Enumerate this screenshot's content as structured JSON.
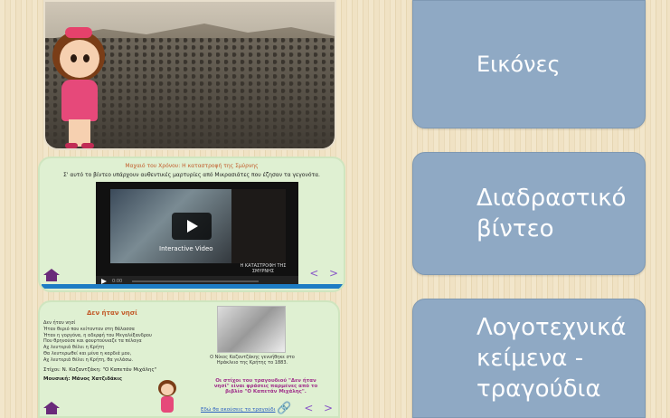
{
  "cards": {
    "photo": {},
    "video": {
      "title": "Μαχαιό του Χρόνου: Η καταστροφή της Σμύρνης",
      "subtitle": "Σ' αυτό το βίντεο υπάρχουν αυθεντικές μαρτυρίες από Μικρασιάτες που έζησαν τα γεγονότα.",
      "player_label": "Interactive Video",
      "player_caption": "Η ΚΑΤΑΣΤΡΟΦΗ ΤΗΣ ΣΜΥΡΝΗΣ",
      "time": "0:00",
      "prev": "<",
      "next": ">"
    },
    "literary": {
      "title": "Δεν ήταν νησί",
      "verses": [
        "Δεν ήταν νησί",
        "Ήταν θεριό που κείτονταν στη θάλασσα",
        "Ήταν η γοργόνα, η αδερφή του Μεγαλέξανδρου",
        "Που θρηνούσε και φουρτούνιαζε τα πέλαγα",
        "Αχ λευτεριά θέλει η Κρήτη",
        "Θα λευτερωθεί και μένα η καρδιά μου,",
        "Αχ λευτεριά θέλει η Κρήτη, θα γελάσω."
      ],
      "lyrics": "Στίχοι: Ν. Καζαντζάκη: \"Ο Καπετάν Μιχάλης\"",
      "music": "Μουσική: Μάνος Χατζιδάκις",
      "photo_caption": "Ο Νίκος Καζαντζάκης γεννήθηκε στο Ηράκλειο της Κρήτης το 1883.",
      "quote": "Οι στίχοι του τραγουδιού \"Δεν ήταν νησί\" είναι φράσεις παρμένες από το βιβλίο \"Ο Καπετάν Μιχάλης\".",
      "link": "Εδώ θα ακούσεις το τραγούδι",
      "prev": "<",
      "next": ">"
    }
  },
  "buttons": {
    "images": "Εικόνες",
    "video_line1": "Διαδραστικό",
    "video_line2": "βίντεο",
    "lit_line1": "Λογοτεχνικά",
    "lit_line2": "κείμενα -",
    "lit_line3": "τραγούδια"
  },
  "colors": {
    "button_bg": "#8fa9c4",
    "card_bg": "#dff0d2",
    "accent_purple": "#8a58c7",
    "title_orange": "#c25b2a"
  }
}
